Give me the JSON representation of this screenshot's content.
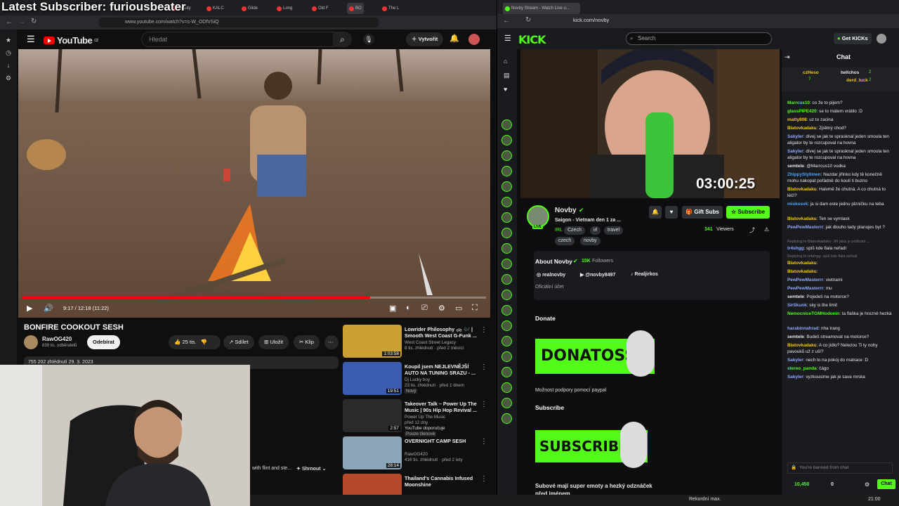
{
  "overlay": "Latest Subscriber: furiousbeater",
  "left_browser": {
    "tabs": [
      "Beauty",
      "KALC",
      "Glide",
      "Long",
      "Old F",
      "BO",
      "The L"
    ],
    "url": "www.youtube.com/watch?v=s-W_ODfVSiQ"
  },
  "youtube": {
    "logo": "YouTube",
    "country": "CZ",
    "search_placeholder": "Hledat",
    "create_label": "Vytvořit",
    "time": "9:17 / 12:18 (11:22)",
    "progress": 0.75,
    "video_title": "BONFIRE COOKOUT SESH",
    "channel_name": "RawOG420",
    "subs": "839 tis. odběratelů",
    "subscribe_label": "Odebírat",
    "likes": "25 tis.",
    "share_label": "Sdílet",
    "save_label": "Uložit",
    "clip_label": "Klip",
    "desc_meta": "755 202 zhlédnutí  29. 3. 2023",
    "desc_more": "with flint and ste...",
    "collapse_label": "Shrnout",
    "recs": [
      {
        "title": "Lowrider Philosophy 🚓 🎶 | Smooth West Coast G-Funk ...",
        "channel": "West Coast Street Legacy",
        "meta": "8 tis. zhlédnutí · před 2 měsíci",
        "duration": "1:03:58"
      },
      {
        "title": "Koupil jsem NEJLEVNĚJŠÍ AUTO NA TUNING SRAZU - ...",
        "channel": "Dj Lucky boy",
        "meta": "23 tis. zhlédnutí · před 1 dnem",
        "badge": "Nový",
        "duration": "19:51"
      },
      {
        "title": "Takeover Talk – Power Up The Music | 90s Hip Hop Revival ...",
        "channel": "Power Up The Music",
        "meta": "před 12 dny",
        "extra": "YouTube doporučuje",
        "badge": "Pouze členové",
        "duration": "2:57"
      },
      {
        "title": "OVERNIGHT CAMP SESH",
        "channel": "RawOG420",
        "meta": "416 tis. zhlédnutí · před 2 lety",
        "duration": "28:14"
      },
      {
        "title": "Thailand's Cannabis Infused Moonshine",
        "channel": "",
        "meta": "",
        "duration": ""
      }
    ]
  },
  "right_browser": {
    "tab_title": "Novby Stream - Watch Live o...",
    "url": "kick.com/novby"
  },
  "kick": {
    "logo": "KICK",
    "search_placeholder": "Search",
    "get_kicks": "Get KICKs",
    "timer": "03:00:25",
    "streamer": "Novby",
    "stream_title": "Saigon - Vietnam den 1 za ...",
    "tags": [
      "IRL",
      "Czech",
      "irl",
      "travel",
      "czech",
      "novby"
    ],
    "live": "LIVE",
    "viewers": "341",
    "viewers_label": "Viewers",
    "gift_subs": "Gift Subs",
    "subscribe": "Subscribe",
    "about_title": "About Novby",
    "followers": "15K",
    "followers_label": "Followers",
    "socials": [
      "realnovby",
      "@novby8497",
      "Realjirkos"
    ],
    "official": "Oficiální účet",
    "donate_h": "Donate",
    "donate_panel": "DONATOSS",
    "donate_desc": "Možnost podpory pomocí paypal",
    "subscribe_h": "Subscribe",
    "sub_panel": "SUBSCRIBE",
    "sub_desc": "Subové mají super emoty a hezký odznáček před jménem"
  },
  "chat": {
    "title": "Chat",
    "leaders": [
      "czHeso",
      "twitchos",
      "derd_luck"
    ],
    "leader_counts": [
      "7",
      "2",
      "2"
    ],
    "messages": [
      {
        "u": "Marrcus10",
        "c": "#53fc18",
        "t": "co že to pijem?"
      },
      {
        "u": "glassPIPE420",
        "c": "#53fc18",
        "t": "se to málem vrátilo :D"
      },
      {
        "u": "matty808",
        "c": "#f5c518",
        "t": "uz to zacina"
      },
      {
        "u": "Blatovkadaku",
        "c": "#f5c518",
        "t": "Zpětný chod?"
      },
      {
        "u": "Sakyler",
        "c": "#8fa8ff",
        "t": "dívej se jak te sprasknal jeden smoula ten aligator by te rozcupoval na hovna"
      },
      {
        "u": "Sakyler",
        "c": "#8fa8ff",
        "t": "dívej se jak te sprasknal jeden smoula ten aligator by te rozcupoval na hovna"
      },
      {
        "u": "semtele",
        "c": "#e6e6e6",
        "t": "@Marrcus10 vodka"
      },
      {
        "u": "ZhippyStyllmen",
        "c": "#4aa3ff",
        "t": "Nazdar jiřinko kdy tě konečně mohu nakopat pořádně do koulí ti buzno"
      },
      {
        "u": "Blatovkadaku",
        "c": "#f5c518",
        "t": "Halvmě že chutná. A co chutná to léčí?"
      },
      {
        "u": "miskosvk",
        "c": "#4aa3ff",
        "t": "ja si dam este jednu plzničku na teba"
      },
      {
        "u": "Blatovkadaku",
        "c": "#f5c518",
        "t": "Ten se vymlask"
      },
      {
        "u": "PewPewMasterrr",
        "c": "#8fa8ff",
        "t": "jak dlouho tady planujes byt ?"
      },
      {
        "u": "tr4shgg",
        "c": "#8fa8ff",
        "t": "spíš kde fiala neřadí"
      },
      {
        "u": "Blatovkadaku",
        "c": "#f5c518",
        "t": ""
      },
      {
        "u": "Blatovkadaku",
        "c": "#f5c518",
        "t": ""
      },
      {
        "u": "PewPewMasterrr",
        "c": "#8fa8ff",
        "t": "vietnami"
      },
      {
        "u": "PewPewMasterrr",
        "c": "#8fa8ff",
        "t": "mu"
      },
      {
        "u": "semtele",
        "c": "#e6e6e6",
        "t": "Pojedeš na motorce?"
      },
      {
        "u": "SirSkunk",
        "c": "#8fa8ff",
        "t": "sky is the limit"
      },
      {
        "u": "NemocniceTGMHodonin",
        "c": "#53fc18",
        "t": "ta flaška je hrozně hezká"
      },
      {
        "u": "harabinnahrad",
        "c": "#8fa8ff",
        "t": "nha trang"
      },
      {
        "u": "semtele",
        "c": "#e6e6e6",
        "t": "Budeš streamovat na motorce?"
      },
      {
        "u": "Blatovkadaku",
        "c": "#f5c518",
        "t": "A co jídlo? Nelezou Ti ty nohy pavouků už z uší?"
      },
      {
        "u": "Sakyler",
        "c": "#8fa8ff",
        "t": "nech to na pokoj do matrace :D"
      },
      {
        "u": "stereo_panda",
        "c": "#53fc18",
        "t": "čágo"
      },
      {
        "u": "Sakyler",
        "c": "#8fa8ff",
        "t": "vyzkousime jak je sava mrska"
      }
    ],
    "replies": [
      "Replying to Blatovkadaku: Jiří jaká je politická ...",
      "Replying to tr4shgg: spíš kde fiala neřadí"
    ],
    "banned": "You're banned from chat",
    "kicks": "10,450",
    "points": "0",
    "chat_btn": "Chat"
  },
  "taskbar": {
    "label": "Rekordní max.",
    "time": "21:00"
  }
}
